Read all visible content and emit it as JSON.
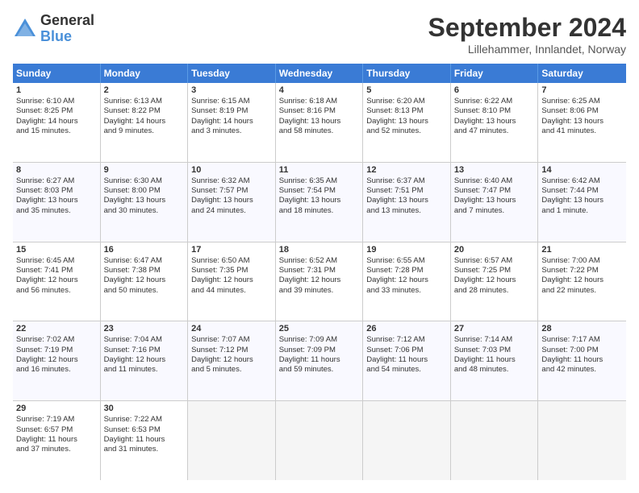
{
  "logo": {
    "general": "General",
    "blue": "Blue"
  },
  "title": "September 2024",
  "subtitle": "Lillehammer, Innlandet, Norway",
  "headers": [
    "Sunday",
    "Monday",
    "Tuesday",
    "Wednesday",
    "Thursday",
    "Friday",
    "Saturday"
  ],
  "rows": [
    [
      {
        "day": "1",
        "lines": [
          "Sunrise: 6:10 AM",
          "Sunset: 8:25 PM",
          "Daylight: 14 hours",
          "and 15 minutes."
        ]
      },
      {
        "day": "2",
        "lines": [
          "Sunrise: 6:13 AM",
          "Sunset: 8:22 PM",
          "Daylight: 14 hours",
          "and 9 minutes."
        ]
      },
      {
        "day": "3",
        "lines": [
          "Sunrise: 6:15 AM",
          "Sunset: 8:19 PM",
          "Daylight: 14 hours",
          "and 3 minutes."
        ]
      },
      {
        "day": "4",
        "lines": [
          "Sunrise: 6:18 AM",
          "Sunset: 8:16 PM",
          "Daylight: 13 hours",
          "and 58 minutes."
        ]
      },
      {
        "day": "5",
        "lines": [
          "Sunrise: 6:20 AM",
          "Sunset: 8:13 PM",
          "Daylight: 13 hours",
          "and 52 minutes."
        ]
      },
      {
        "day": "6",
        "lines": [
          "Sunrise: 6:22 AM",
          "Sunset: 8:10 PM",
          "Daylight: 13 hours",
          "and 47 minutes."
        ]
      },
      {
        "day": "7",
        "lines": [
          "Sunrise: 6:25 AM",
          "Sunset: 8:06 PM",
          "Daylight: 13 hours",
          "and 41 minutes."
        ]
      }
    ],
    [
      {
        "day": "8",
        "lines": [
          "Sunrise: 6:27 AM",
          "Sunset: 8:03 PM",
          "Daylight: 13 hours",
          "and 35 minutes."
        ]
      },
      {
        "day": "9",
        "lines": [
          "Sunrise: 6:30 AM",
          "Sunset: 8:00 PM",
          "Daylight: 13 hours",
          "and 30 minutes."
        ]
      },
      {
        "day": "10",
        "lines": [
          "Sunrise: 6:32 AM",
          "Sunset: 7:57 PM",
          "Daylight: 13 hours",
          "and 24 minutes."
        ]
      },
      {
        "day": "11",
        "lines": [
          "Sunrise: 6:35 AM",
          "Sunset: 7:54 PM",
          "Daylight: 13 hours",
          "and 18 minutes."
        ]
      },
      {
        "day": "12",
        "lines": [
          "Sunrise: 6:37 AM",
          "Sunset: 7:51 PM",
          "Daylight: 13 hours",
          "and 13 minutes."
        ]
      },
      {
        "day": "13",
        "lines": [
          "Sunrise: 6:40 AM",
          "Sunset: 7:47 PM",
          "Daylight: 13 hours",
          "and 7 minutes."
        ]
      },
      {
        "day": "14",
        "lines": [
          "Sunrise: 6:42 AM",
          "Sunset: 7:44 PM",
          "Daylight: 13 hours",
          "and 1 minute."
        ]
      }
    ],
    [
      {
        "day": "15",
        "lines": [
          "Sunrise: 6:45 AM",
          "Sunset: 7:41 PM",
          "Daylight: 12 hours",
          "and 56 minutes."
        ]
      },
      {
        "day": "16",
        "lines": [
          "Sunrise: 6:47 AM",
          "Sunset: 7:38 PM",
          "Daylight: 12 hours",
          "and 50 minutes."
        ]
      },
      {
        "day": "17",
        "lines": [
          "Sunrise: 6:50 AM",
          "Sunset: 7:35 PM",
          "Daylight: 12 hours",
          "and 44 minutes."
        ]
      },
      {
        "day": "18",
        "lines": [
          "Sunrise: 6:52 AM",
          "Sunset: 7:31 PM",
          "Daylight: 12 hours",
          "and 39 minutes."
        ]
      },
      {
        "day": "19",
        "lines": [
          "Sunrise: 6:55 AM",
          "Sunset: 7:28 PM",
          "Daylight: 12 hours",
          "and 33 minutes."
        ]
      },
      {
        "day": "20",
        "lines": [
          "Sunrise: 6:57 AM",
          "Sunset: 7:25 PM",
          "Daylight: 12 hours",
          "and 28 minutes."
        ]
      },
      {
        "day": "21",
        "lines": [
          "Sunrise: 7:00 AM",
          "Sunset: 7:22 PM",
          "Daylight: 12 hours",
          "and 22 minutes."
        ]
      }
    ],
    [
      {
        "day": "22",
        "lines": [
          "Sunrise: 7:02 AM",
          "Sunset: 7:19 PM",
          "Daylight: 12 hours",
          "and 16 minutes."
        ]
      },
      {
        "day": "23",
        "lines": [
          "Sunrise: 7:04 AM",
          "Sunset: 7:16 PM",
          "Daylight: 12 hours",
          "and 11 minutes."
        ]
      },
      {
        "day": "24",
        "lines": [
          "Sunrise: 7:07 AM",
          "Sunset: 7:12 PM",
          "Daylight: 12 hours",
          "and 5 minutes."
        ]
      },
      {
        "day": "25",
        "lines": [
          "Sunrise: 7:09 AM",
          "Sunset: 7:09 PM",
          "Daylight: 11 hours",
          "and 59 minutes."
        ]
      },
      {
        "day": "26",
        "lines": [
          "Sunrise: 7:12 AM",
          "Sunset: 7:06 PM",
          "Daylight: 11 hours",
          "and 54 minutes."
        ]
      },
      {
        "day": "27",
        "lines": [
          "Sunrise: 7:14 AM",
          "Sunset: 7:03 PM",
          "Daylight: 11 hours",
          "and 48 minutes."
        ]
      },
      {
        "day": "28",
        "lines": [
          "Sunrise: 7:17 AM",
          "Sunset: 7:00 PM",
          "Daylight: 11 hours",
          "and 42 minutes."
        ]
      }
    ],
    [
      {
        "day": "29",
        "lines": [
          "Sunrise: 7:19 AM",
          "Sunset: 6:57 PM",
          "Daylight: 11 hours",
          "and 37 minutes."
        ]
      },
      {
        "day": "30",
        "lines": [
          "Sunrise: 7:22 AM",
          "Sunset: 6:53 PM",
          "Daylight: 11 hours",
          "and 31 minutes."
        ]
      },
      {
        "day": "",
        "lines": [],
        "empty": true
      },
      {
        "day": "",
        "lines": [],
        "empty": true
      },
      {
        "day": "",
        "lines": [],
        "empty": true
      },
      {
        "day": "",
        "lines": [],
        "empty": true
      },
      {
        "day": "",
        "lines": [],
        "empty": true
      }
    ]
  ]
}
